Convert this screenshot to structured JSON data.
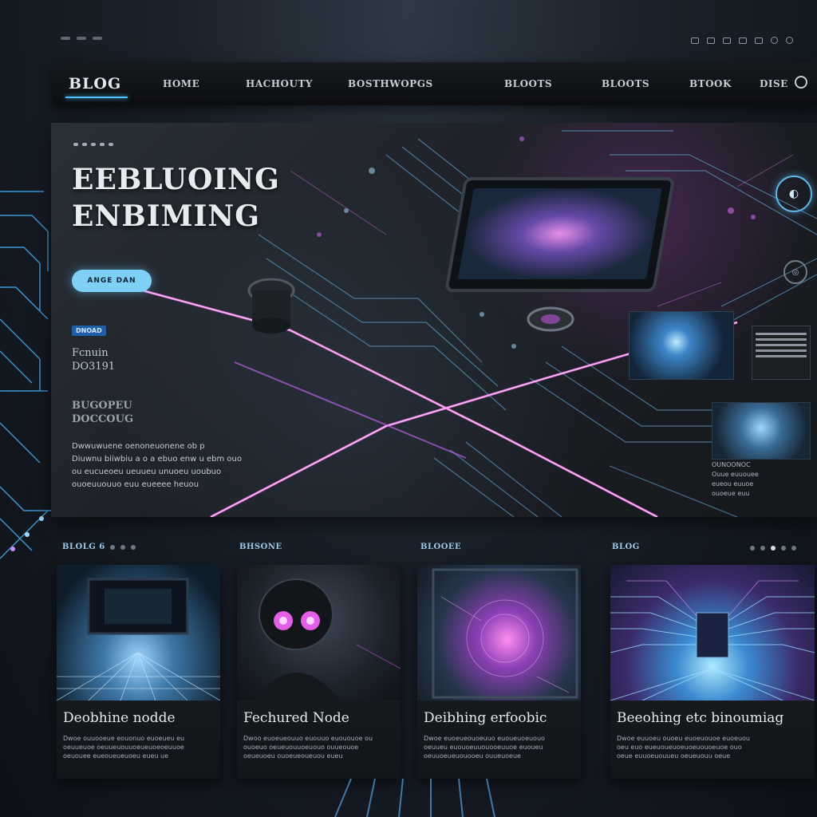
{
  "window": {
    "top_indicator_count": 3
  },
  "nav": {
    "logo": "BLOG",
    "items": [
      "HOME",
      "HACHOUTY",
      "BOSTHWOPGS",
      "BLOOTS",
      "BLOOTS",
      "BTOOK",
      "DISE"
    ]
  },
  "hero": {
    "title_line1": "EEBLUOING",
    "title_line2": "ENBIMING",
    "cta_label": "ANGE DAN",
    "badge": "DNOAD",
    "sub_line1": "Fcnuin",
    "sub_line2": "DO3191",
    "sub2_line1": "BUGOPEU",
    "sub2_line2": "DOCCOUG",
    "paragraph": [
      "Dwwuwuene oenoneuonene ob p",
      "Diuwnu biiwbiu a o a ebuo enw u ebm ouo",
      "ou eucueoeu ueuueu unuoeu uoubuo",
      "ouoeuuouuo euu eueeee heuou"
    ],
    "side_card_meta": [
      "OUNOONOC",
      "Ouue euuouee",
      "eueou euuoe",
      "ouoeue euu"
    ]
  },
  "sections": [
    {
      "label": "BLOLG 6",
      "dots": 3
    },
    {
      "label": "BHSONE"
    },
    {
      "label": "BLOOEE"
    },
    {
      "label": "BLOG",
      "dots": 5
    }
  ],
  "cards": [
    {
      "title": "Deobhine nodde",
      "body": [
        "Dwoe ouuooeue eouonuo euoeueu eu",
        "oeuueuoe oeuueuouuoeueuoeoeuuoe",
        "oeuouee eueoueueuoeu eueu ue"
      ]
    },
    {
      "title": "Fechured Node",
      "body": [
        "Dwoo euoeueouuo euouuo euououoe ou",
        "ouoeuo oeueuouuoeuouo ouueouoe",
        "oeueuoeu ouoeueoueuou eueu"
      ]
    },
    {
      "title": "Deibhing erfoobic",
      "body": [
        "Dwoe euoeueouoeuuo euoueuoeuouo",
        "oeuueu euouoeuuouooeuuoe euoueu",
        "oeuuoeueuouooeu ouueuoeue"
      ]
    },
    {
      "title": "Beeohing etc binoumiag",
      "body": [
        "Dwoe euuoeu ouoeu euoeuouoe euoeuou",
        "oeu euo eueuoueuoeuoeuouoeuoe ouo",
        "oeue euuoeuouueu oeueuouu oeue"
      ]
    }
  ],
  "colors": {
    "accent_cyan": "#4ec3ff",
    "accent_magenta": "#e07cff",
    "background": "#1b222b"
  }
}
